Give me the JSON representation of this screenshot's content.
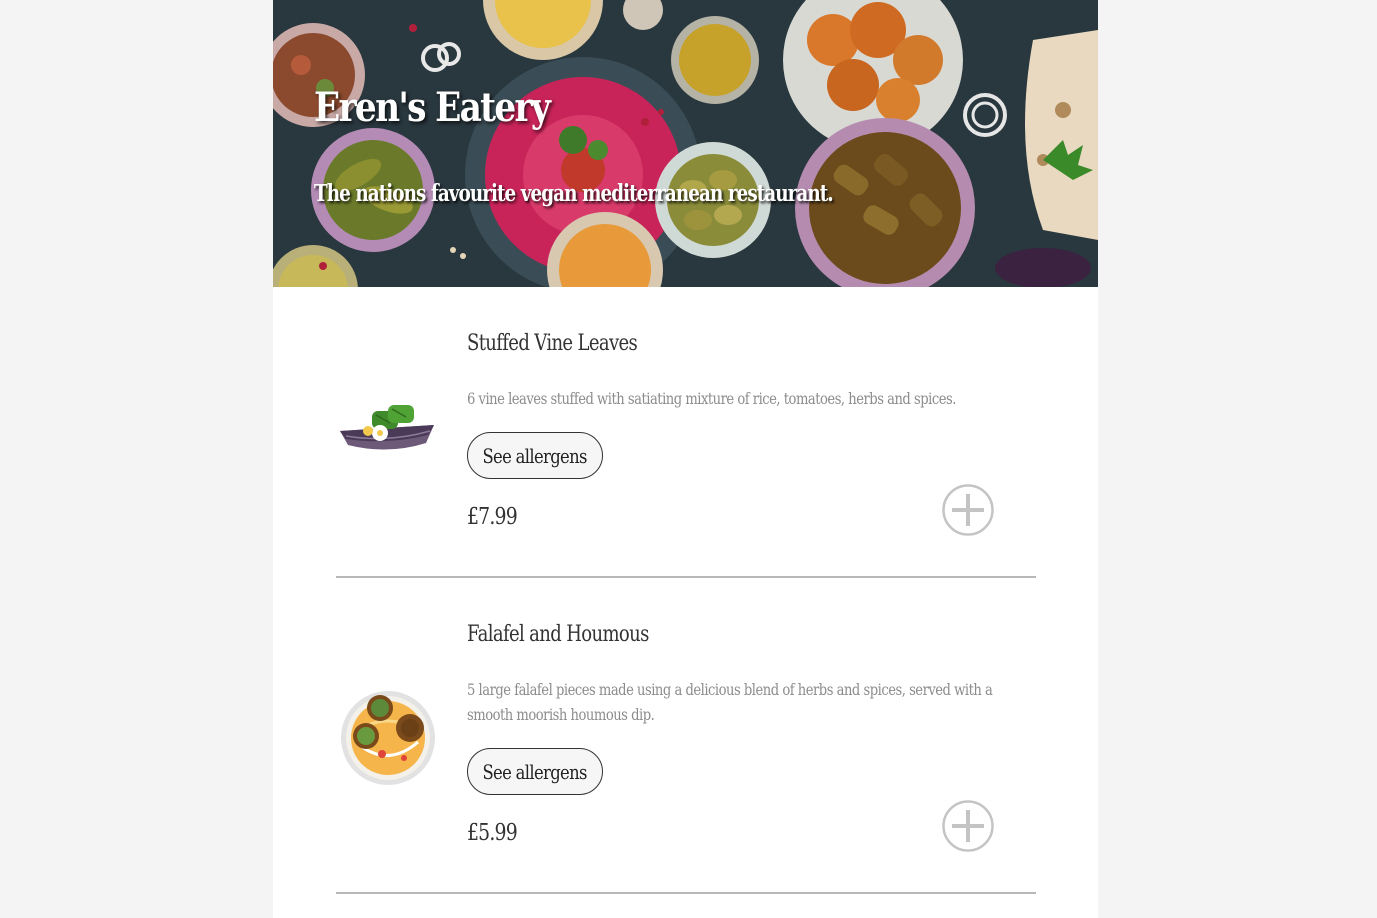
{
  "restaurant": {
    "name": "Eren's Eatery",
    "tagline": "The nations favourite vegan mediterranean restaurant."
  },
  "menu": {
    "items": [
      {
        "name": "Stuffed Vine Leaves",
        "description": "6 vine leaves stuffed with satiating mixture of rice, tomatoes, herbs and spices.",
        "allergens_label": "See allergens",
        "price": "£7.99",
        "image_icon": "stuffed-vine-leaves-icon",
        "add_icon": "plus-circle-icon"
      },
      {
        "name": "Falafel and Houmous",
        "description": "5 large falafel pieces made using a delicious blend of herbs and spices, served with a smooth moorish houmous dip.",
        "allergens_label": "See allergens",
        "price": "£5.99",
        "image_icon": "falafel-houmous-icon",
        "add_icon": "plus-circle-icon"
      }
    ]
  },
  "colors": {
    "page_background": "#f4f4f4",
    "card_background": "#ffffff",
    "text_primary": "#333333",
    "text_secondary": "#8c8c8c",
    "divider": "#b8b8b8",
    "add_icon": "#c4c4c4"
  }
}
